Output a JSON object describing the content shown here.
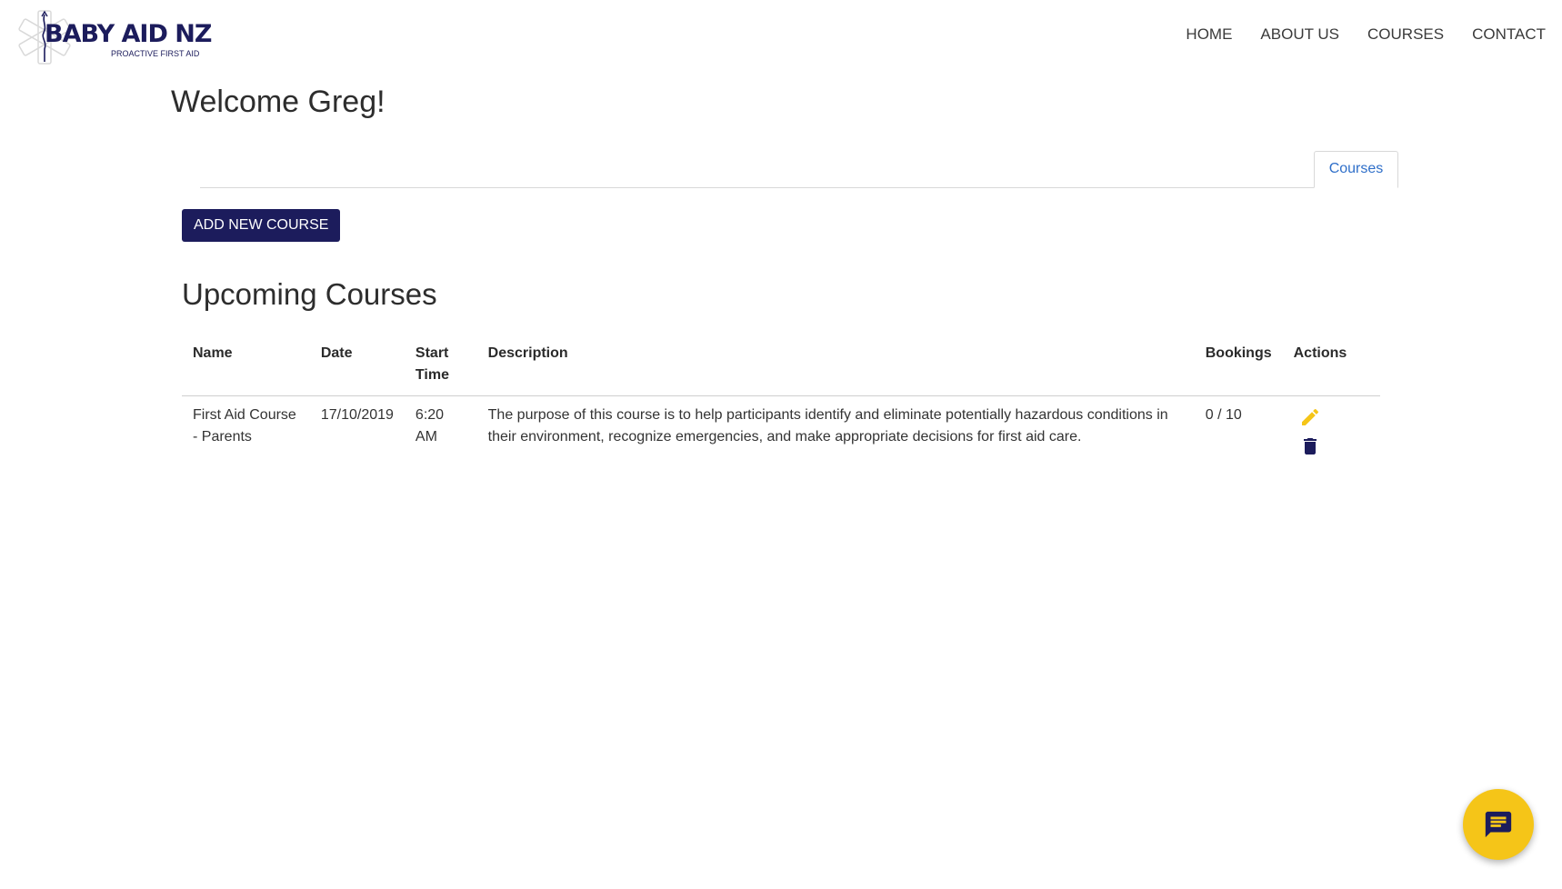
{
  "brand": {
    "name": "BABY AID NZ",
    "tagline": "PROACTIVE FIRST AID"
  },
  "nav": {
    "items": [
      {
        "label": "HOME"
      },
      {
        "label": "ABOUT US"
      },
      {
        "label": "COURSES"
      },
      {
        "label": "CONTACT"
      }
    ]
  },
  "welcome": "Welcome Greg!",
  "tabs": [
    {
      "label": "Courses",
      "active": true
    }
  ],
  "add_course_label": "ADD NEW COURSE",
  "section_title": "Upcoming Courses",
  "table": {
    "headers": {
      "name": "Name",
      "date": "Date",
      "start_time": "Start Time",
      "description": "Description",
      "bookings": "Bookings",
      "actions": "Actions"
    },
    "rows": [
      {
        "name": "First Aid Course - Parents",
        "date": "17/10/2019",
        "start_time": "6:20 AM",
        "description": "The purpose of this course is to help participants identify and eliminate potentially hazardous conditions in their environment, recognize emergencies, and make appropriate decisions for first aid care.",
        "bookings": "0 / 10",
        "actions": [
          "edit-icon",
          "trash-icon"
        ]
      }
    ]
  },
  "colors": {
    "brand_navy": "#1c1c5c",
    "tab_link_blue": "#2f6fc9",
    "edit_yellow": "#f5c518",
    "chat_yellow": "#f5c518"
  },
  "chat_widget": {
    "icon": "chat-icon"
  }
}
